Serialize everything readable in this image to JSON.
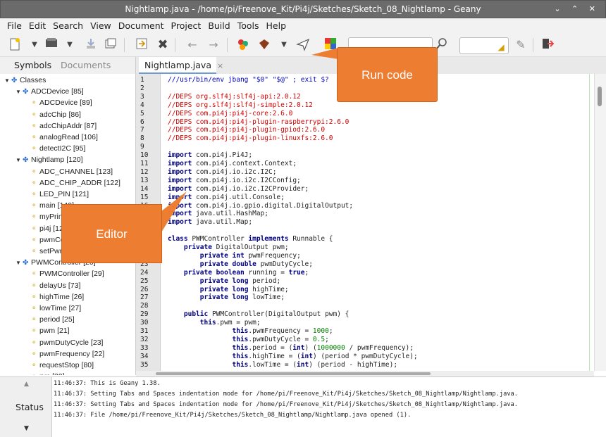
{
  "window": {
    "title": "Nightlamp.java - /home/pi/Freenove_Kit/Pi4j/Sketches/Sketch_08_Nightlamp - Geany",
    "controls": "⌄ ⌃ ✕"
  },
  "menu": [
    "File",
    "Edit",
    "Search",
    "View",
    "Document",
    "Project",
    "Build",
    "Tools",
    "Help"
  ],
  "toolbar": {
    "icons": [
      "new-file-icon",
      "open-file-icon",
      "save-icon",
      "save-all-icon",
      "revert-icon",
      "close-icon",
      "back-icon",
      "forward-icon",
      "compile-icon",
      "build-icon",
      "run-icon",
      "color-chooser-icon",
      "search-icon",
      "jump-to-line-icon",
      "quit-icon"
    ],
    "search_value": "",
    "goto_value": ""
  },
  "sidebar": {
    "tabs": [
      "Symbols",
      "Documents"
    ],
    "tree": [
      {
        "label": "Classes",
        "level": 0,
        "expanded": true
      },
      {
        "label": "ADCDevice [85]",
        "level": 1,
        "expanded": true
      },
      {
        "label": "ADCDevice [89]",
        "level": 2
      },
      {
        "label": "adcChip [86]",
        "level": 2
      },
      {
        "label": "adcChipAddr [87]",
        "level": 2
      },
      {
        "label": "analogRead [106]",
        "level": 2
      },
      {
        "label": "detectI2C [95]",
        "level": 2
      },
      {
        "label": "Nightlamp [120]",
        "level": 1,
        "expanded": true
      },
      {
        "label": "ADC_CHANNEL [123]",
        "level": 2
      },
      {
        "label": "ADC_CHIP_ADDR [122]",
        "level": 2
      },
      {
        "label": "LED_PIN [121]",
        "level": 2
      },
      {
        "label": "main [149]",
        "level": 2
      },
      {
        "label": "myPrint",
        "level": 2
      },
      {
        "label": "pi4j [12",
        "level": 2
      },
      {
        "label": "pwmCo",
        "level": 2
      },
      {
        "label": "setPwm",
        "level": 2
      },
      {
        "label": "PWMController [20]",
        "level": 1,
        "expanded": true
      },
      {
        "label": "PWMController [29]",
        "level": 2
      },
      {
        "label": "delayUs [73]",
        "level": 2
      },
      {
        "label": "highTime [26]",
        "level": 2
      },
      {
        "label": "lowTime [27]",
        "level": 2
      },
      {
        "label": "period [25]",
        "level": 2
      },
      {
        "label": "pwm [21]",
        "level": 2
      },
      {
        "label": "pwmDutyCycle [23]",
        "level": 2
      },
      {
        "label": "pwmFrequency [22]",
        "level": 2
      },
      {
        "label": "requestStop [80]",
        "level": 2
      },
      {
        "label": "run [39]",
        "level": 2
      }
    ]
  },
  "editor": {
    "tab_label": "Nightlamp.java",
    "lines": [
      {
        "n": "1",
        "t": "///usr/bin/env jbang \"$0\" \"$@\" ; exit $?",
        "c": "str"
      },
      {
        "n": "2",
        "t": "",
        "c": ""
      },
      {
        "n": "3",
        "t": "//DEPS org.slf4j:slf4j-api:2.0.12",
        "c": "c1"
      },
      {
        "n": "4",
        "t": "//DEPS org.slf4j:slf4j-simple:2.0.12",
        "c": "c1"
      },
      {
        "n": "5",
        "t": "//DEPS com.pi4j:pi4j-core:2.6.0",
        "c": "c1"
      },
      {
        "n": "6",
        "t": "//DEPS com.pi4j:pi4j-plugin-raspberrypi:2.6.0",
        "c": "c1"
      },
      {
        "n": "7",
        "t": "//DEPS com.pi4j:pi4j-plugin-gpiod:2.6.0",
        "c": "c1"
      },
      {
        "n": "8",
        "t": "//DEPS com.pi4j:pi4j-plugin-linuxfs:2.6.0",
        "c": "c1"
      },
      {
        "n": "9",
        "t": "",
        "c": ""
      },
      {
        "n": "10",
        "t": "import com.pi4j.Pi4J;",
        "c": "imp"
      },
      {
        "n": "11",
        "t": "import com.pi4j.context.Context;",
        "c": "imp"
      },
      {
        "n": "12",
        "t": "import com.pi4j.io.i2c.I2C;",
        "c": "imp"
      },
      {
        "n": "13",
        "t": "import com.pi4j.io.i2c.I2CConfig;",
        "c": "imp"
      },
      {
        "n": "14",
        "t": "import com.pi4j.io.i2c.I2CProvider;",
        "c": "imp"
      },
      {
        "n": "15",
        "t": "import com.pi4j.util.Console;",
        "c": "imp"
      },
      {
        "n": "16",
        "t": "import com.pi4j.io.gpio.digital.DigitalOutput;",
        "c": "imp"
      },
      {
        "n": "17",
        "t": "import java.util.HashMap;",
        "c": "imp"
      },
      {
        "n": "18",
        "t": "import java.util.Map;",
        "c": "imp"
      },
      {
        "n": "19",
        "t": "",
        "c": ""
      },
      {
        "n": "20",
        "t": "class PWMController implements Runnable {",
        "c": ""
      },
      {
        "n": "21",
        "t": "    private DigitalOutput pwm;",
        "c": ""
      },
      {
        "n": "22",
        "t": "        private int pwmFrequency;",
        "c": ""
      },
      {
        "n": "23",
        "t": "        private double pwmDutyCycle;",
        "c": ""
      },
      {
        "n": "24",
        "t": "    private boolean running = true;",
        "c": ""
      },
      {
        "n": "25",
        "t": "        private long period;",
        "c": ""
      },
      {
        "n": "26",
        "t": "        private long highTime;",
        "c": ""
      },
      {
        "n": "27",
        "t": "        private long lowTime;",
        "c": ""
      },
      {
        "n": "28",
        "t": "",
        "c": ""
      },
      {
        "n": "29",
        "t": "    public PWMController(DigitalOutput pwm) {",
        "c": ""
      },
      {
        "n": "30",
        "t": "        this.pwm = pwm;",
        "c": ""
      },
      {
        "n": "31",
        "t": "                this.pwmFrequency = 1000;",
        "c": ""
      },
      {
        "n": "32",
        "t": "                this.pwmDutyCycle = 0.5;",
        "c": ""
      },
      {
        "n": "33",
        "t": "                this.period = (int) (1000000 / pwmFrequency);",
        "c": ""
      },
      {
        "n": "34",
        "t": "                this.highTime = (int) (period * pwmDutyCycle);",
        "c": ""
      },
      {
        "n": "35",
        "t": "                this.lowTime = (int) (period - highTime);",
        "c": ""
      }
    ]
  },
  "messages": {
    "tab_label": "Status",
    "lines": [
      "11:46:37: This is Geany 1.38.",
      "11:46:37: Setting Tabs and Spaces indentation mode for /home/pi/Freenove_Kit/Pi4j/Sketches/Sketch_08_Nightlamp/Nightlamp.java.",
      "11:46:37: Setting Tabs and Spaces indentation mode for /home/pi/Freenove_Kit/Pi4j/Sketches/Sketch_08_Nightlamp/Nightlamp.java.",
      "11:46:37: File /home/pi/Freenove_Kit/Pi4j/Sketches/Sketch_08_Nightlamp/Nightlamp.java opened (1)."
    ]
  },
  "callouts": {
    "run": "Run code",
    "editor": "Editor"
  },
  "colors": {
    "callout": "#ed7d31",
    "highlight": "#e8141e",
    "comment": "#d20000",
    "keyword": "#00007f",
    "number": "#007f00"
  }
}
